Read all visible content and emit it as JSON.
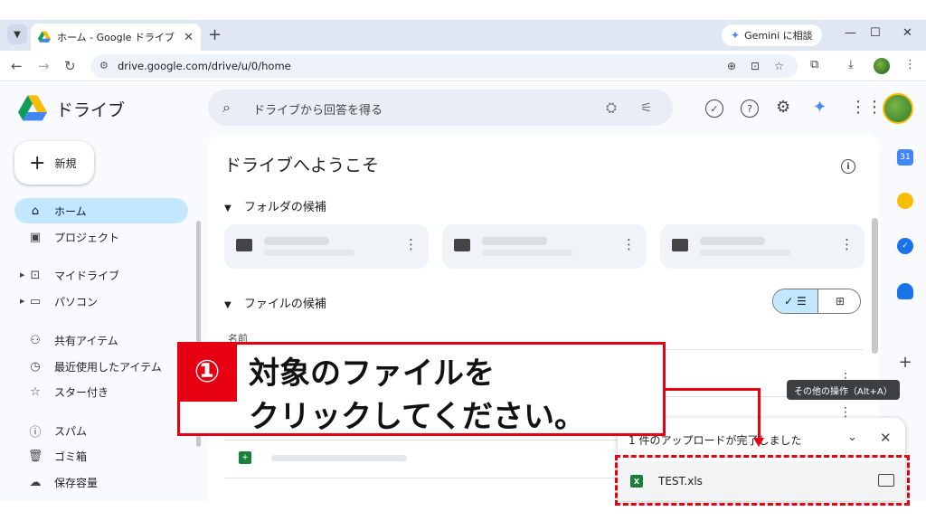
{
  "browser": {
    "tab_title": "ホーム - Google ドライブ",
    "tab_close": "✕",
    "new_tab": "+",
    "gemini_label": "Gemini に相談",
    "url": "drive.google.com/drive/u/0/home"
  },
  "drive": {
    "app_name": "ドライブ",
    "search_placeholder": "ドライブから回答を得る",
    "new_label": "新規",
    "nav": [
      {
        "label": "ホーム",
        "icon": "home-icon",
        "active": true
      },
      {
        "label": "プロジェクト",
        "icon": "project-icon"
      },
      {
        "label": "マイドライブ",
        "icon": "my-drive-icon",
        "expandable": true
      },
      {
        "label": "パソコン",
        "icon": "computer-icon",
        "expandable": true
      },
      {
        "label": "共有アイテム",
        "icon": "shared-icon"
      },
      {
        "label": "最近使用したアイテム",
        "icon": "recent-icon"
      },
      {
        "label": "スター付き",
        "icon": "star-icon"
      },
      {
        "label": "スパム",
        "icon": "spam-icon"
      },
      {
        "label": "ゴミ箱",
        "icon": "trash-icon"
      },
      {
        "label": "保存容量",
        "icon": "storage-icon"
      }
    ],
    "welcome_title": "ドライブへようこそ",
    "folder_section": "フォルダの候補",
    "file_section": "ファイルの候補",
    "name_column": "名前"
  },
  "tooltip": "その他の操作（Alt+A）",
  "upload": {
    "status": "1 件のアップロードが完了しました",
    "file_name": "TEST.xls",
    "file_type_letter": "X"
  },
  "annotation": {
    "step_number": "①",
    "line1": "対象のファイルを",
    "line2": "クリックしてください。"
  },
  "colors": {
    "accent_red": "#e60012",
    "active_nav": "#c2e7ff",
    "sheets_green": "#188038"
  }
}
